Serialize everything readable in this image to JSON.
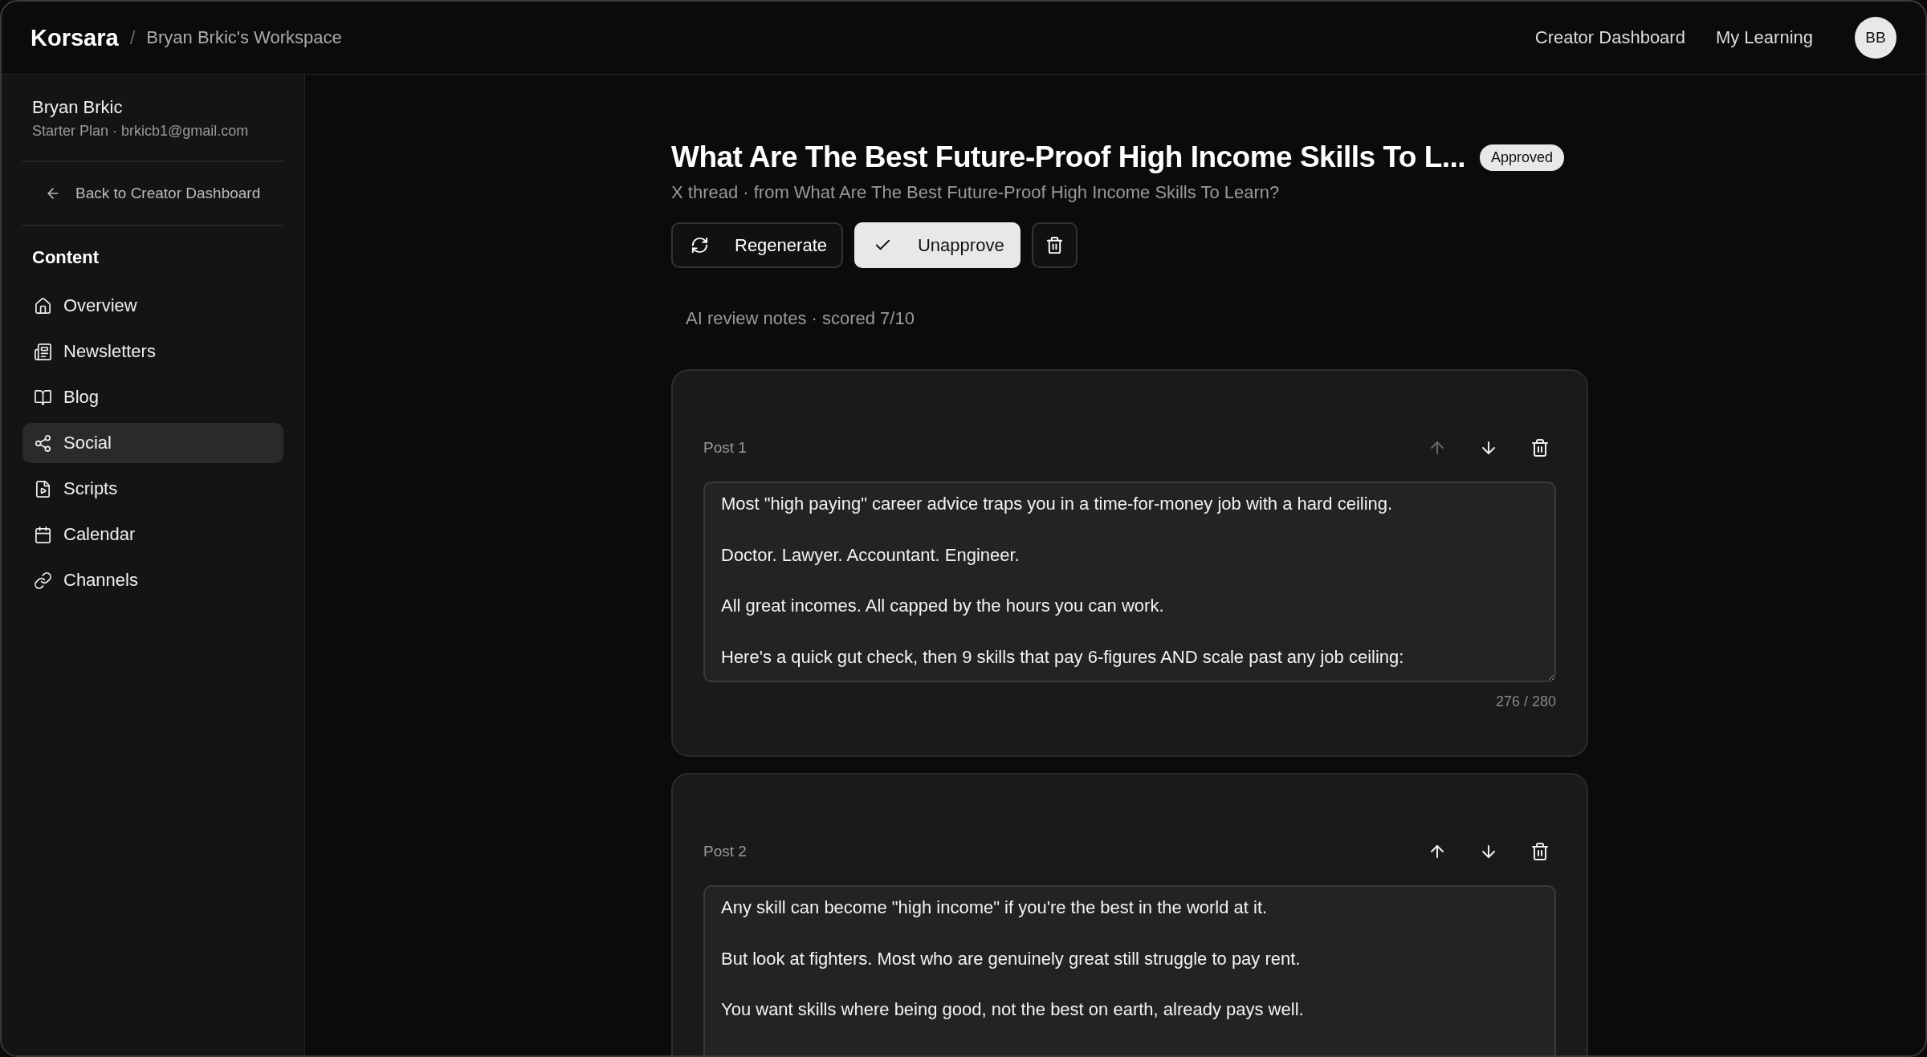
{
  "header": {
    "brand": "Korsara",
    "separator": "/",
    "workspace": "Bryan Brkic's Workspace",
    "links": [
      "Creator Dashboard",
      "My Learning"
    ],
    "avatar": "BB"
  },
  "sidebar": {
    "user_name": "Bryan Brkic",
    "user_meta": "Starter Plan · brkicb1@gmail.com",
    "back_link": "Back to Creator Dashboard",
    "section": "Content",
    "items": [
      {
        "label": "Overview",
        "selected": false
      },
      {
        "label": "Newsletters",
        "selected": false
      },
      {
        "label": "Blog",
        "selected": false
      },
      {
        "label": "Social",
        "selected": true
      },
      {
        "label": "Scripts",
        "selected": false
      },
      {
        "label": "Calendar",
        "selected": false
      },
      {
        "label": "Channels",
        "selected": false
      }
    ]
  },
  "content": {
    "title": "What Are The Best Future-Proof High Income Skills To L...",
    "status": "Approved",
    "subtitle": "X thread · from What Are The Best Future-Proof High Income Skills To Learn?",
    "actions": [
      {
        "kind": "regenerate",
        "label": "Regenerate"
      },
      {
        "kind": "unapprove",
        "label": "Unapprove"
      },
      {
        "kind": "delete"
      }
    ],
    "review_notes": "AI review notes · scored 7/10",
    "posts": [
      {
        "label": "Post 1",
        "up_disabled": true,
        "text": "Most \"high paying\" career advice traps you in a time-for-money job with a hard ceiling.\n\nDoctor. Lawyer. Accountant. Engineer.\n\nAll great incomes. All capped by the hours you can work.\n\nHere's a quick gut check, then 9 skills that pay 6-figures AND scale past any job ceiling:",
        "count": "276 / 280"
      },
      {
        "label": "Post 2",
        "up_disabled": false,
        "text": "Any skill can become \"high income\" if you're the best in the world at it.\n\nBut look at fighters. Most who are genuinely great still struggle to pay rent.\n\nYou want skills where being good, not the best on earth, already pays well."
      }
    ]
  }
}
